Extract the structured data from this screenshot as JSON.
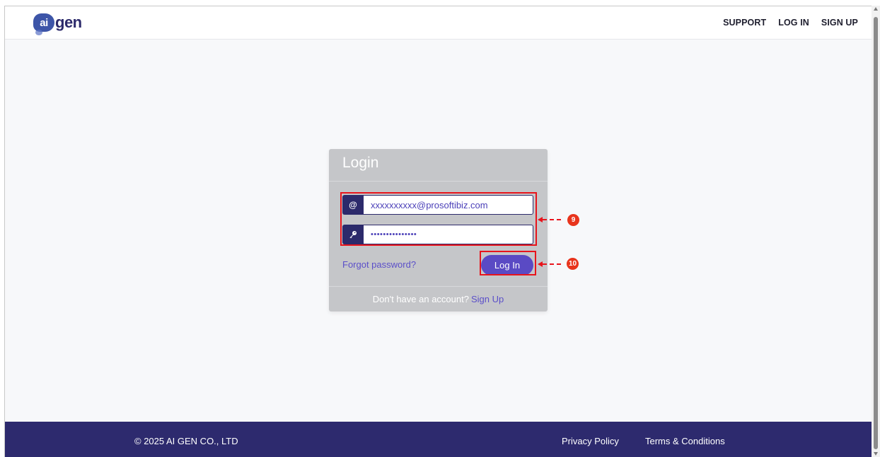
{
  "header": {
    "logo_text": "ai gen",
    "logo_mark": "ai",
    "logo_word": "gen",
    "nav": [
      "SUPPORT",
      "LOG IN",
      "SIGN UP"
    ]
  },
  "login": {
    "title": "Login",
    "email_value": "xxxxxxxxxx@prosoftibiz.com",
    "email_icon": "@",
    "password_value": "•••••••••••••••",
    "password_icon": "key-icon",
    "forgot_label": "Forgot password?",
    "login_button": "Log In",
    "footer_text": "Don't have an account?",
    "signup_link": "Sign Up"
  },
  "annotations": {
    "badge_inputs": "9",
    "badge_login": "10",
    "color": "#e8141c"
  },
  "footer": {
    "copyright": "© 2025 AI GEN CO., LTD",
    "links": [
      "Privacy Policy",
      "Terms & Conditions"
    ]
  },
  "colors": {
    "brand": "#2d2a6e",
    "accent": "#5a4ac4",
    "card": "#c5c6c9"
  }
}
